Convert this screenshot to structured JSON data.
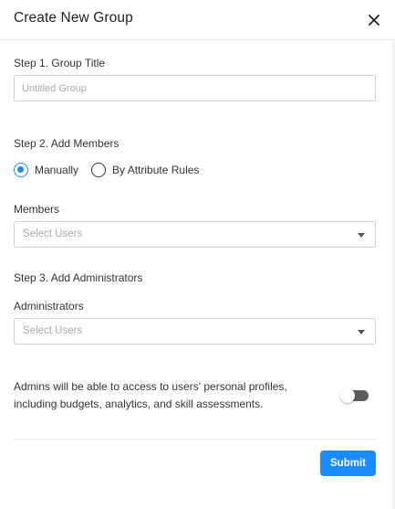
{
  "dialog": {
    "title": "Create New Group",
    "close_icon": "close-icon"
  },
  "step1": {
    "label": "Step 1. Group Title",
    "input_value": "",
    "input_placeholder": "Untitled Group"
  },
  "step2": {
    "label": "Step 2. Add Members",
    "options": [
      {
        "label": "Manually",
        "selected": true
      },
      {
        "label": "By Attribute Rules",
        "selected": false
      }
    ],
    "members_label": "Members",
    "members_placeholder": "Select Users"
  },
  "step3": {
    "label": "Step 3. Add Administrators",
    "admins_label": "Administrators",
    "admins_placeholder": "Select Users"
  },
  "admin_access": {
    "note": "Admins will be able to access to users' personal profiles, including budgets, analytics, and skill assessments.",
    "toggle_on": false
  },
  "footer": {
    "submit_label": "Submit"
  },
  "colors": {
    "accent": "#1a8cff",
    "toggle_off": "#5c5c5c"
  }
}
